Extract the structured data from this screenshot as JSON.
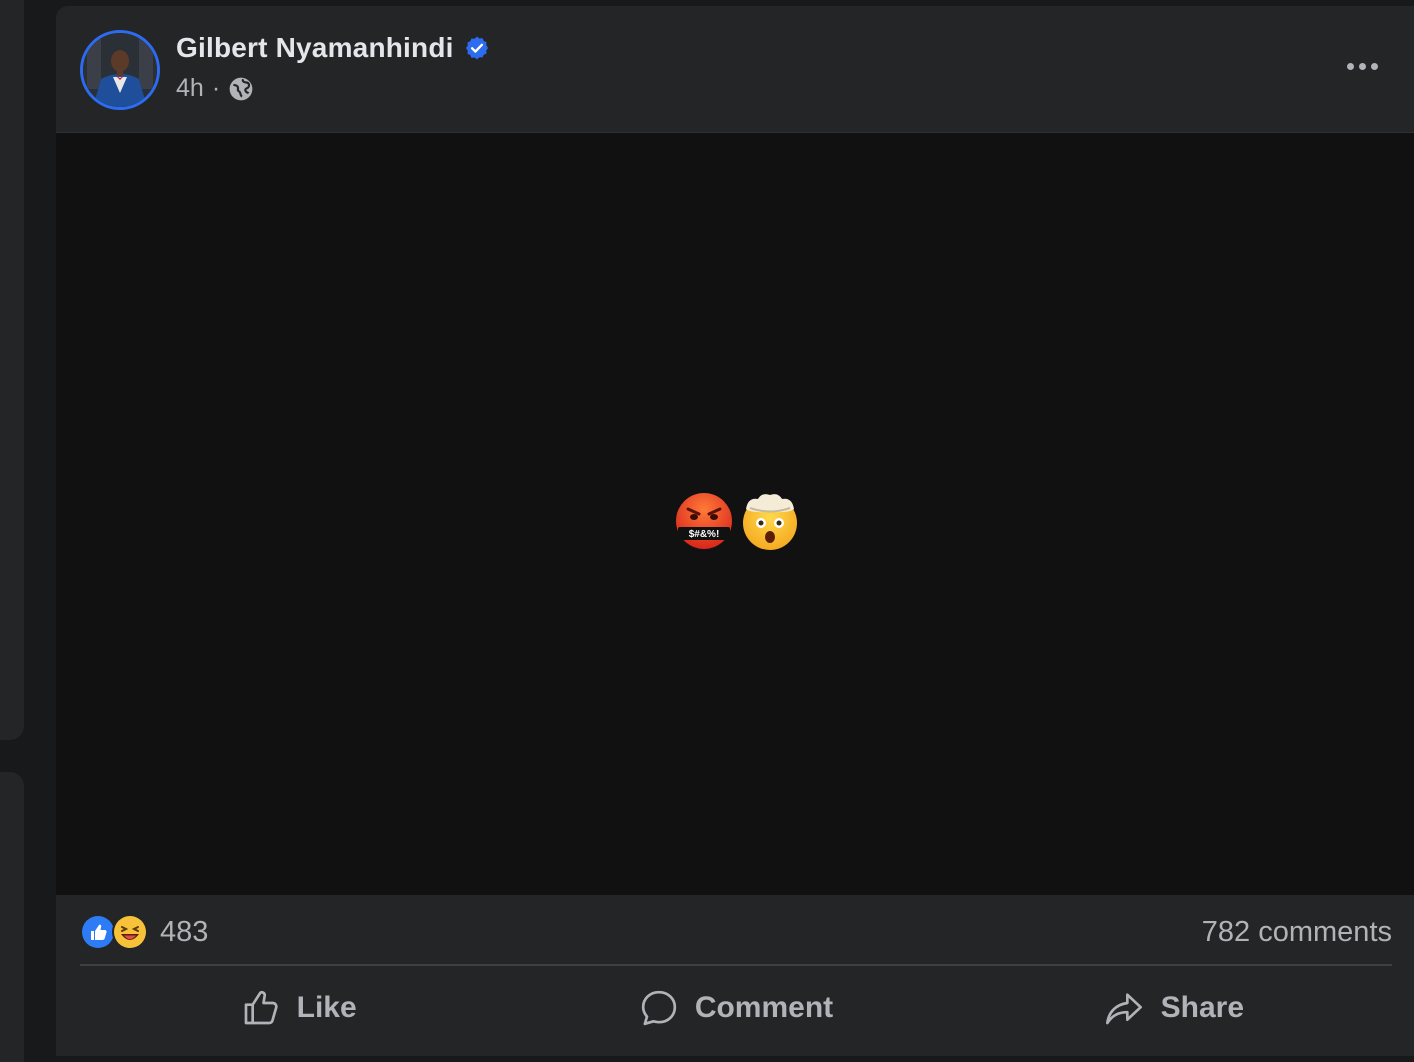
{
  "post": {
    "author": "Gilbert Nyamanhindi",
    "verified": true,
    "time": "4h",
    "separator": "·",
    "audience_icon": "globe-icon",
    "more_icon": "more-options-icon",
    "media_content": "🤬🤯",
    "reactions": {
      "icons": [
        "like-reaction-icon",
        "haha-reaction-icon"
      ],
      "count": "483"
    },
    "comments": "782 comments",
    "actions": [
      {
        "label": "Like",
        "icon": "like-icon"
      },
      {
        "label": "Comment",
        "icon": "comment-icon"
      },
      {
        "label": "Share",
        "icon": "share-icon"
      }
    ]
  },
  "colors": {
    "background": "#18191a",
    "card": "#242526",
    "media": "#111112",
    "primary_text": "#e4e6eb",
    "secondary_text": "#b0b3b8",
    "accent_blue": "#2d6bf0"
  }
}
